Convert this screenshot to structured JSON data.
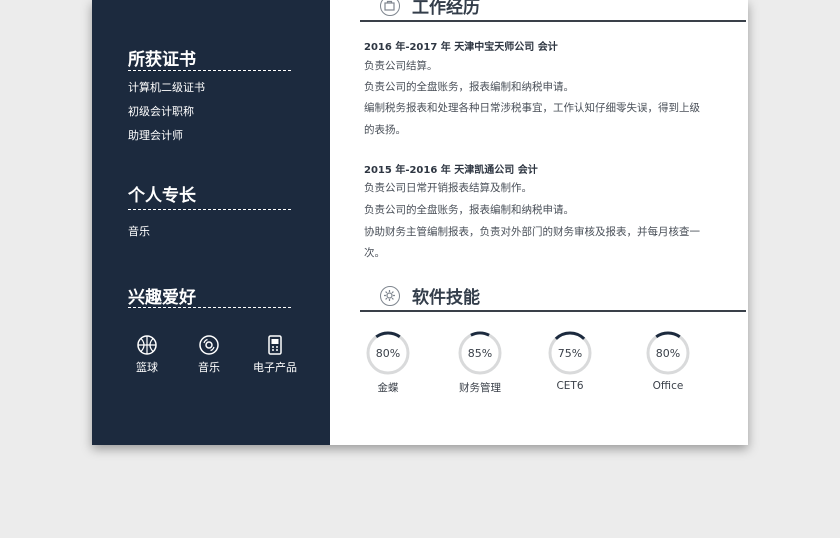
{
  "sidebar": {
    "certs": {
      "title": "所获证书",
      "items": [
        "计算机二级证书",
        "初级会计职称",
        "助理会计师"
      ]
    },
    "skills": {
      "title": "个人专长",
      "items": [
        "音乐"
      ]
    },
    "hobbies": {
      "title": "兴趣爱好",
      "items": [
        {
          "label": "篮球",
          "icon": "basketball-icon"
        },
        {
          "label": "音乐",
          "icon": "music-disc-icon"
        },
        {
          "label": "电子产品",
          "icon": "device-icon"
        }
      ]
    }
  },
  "main": {
    "work": {
      "title": "工作经历",
      "icon": "briefcase-icon",
      "jobs": [
        {
          "header": "2016 年-2017 年  天津中宝天师公司  会计",
          "lines": [
            "负责公司结算。",
            "负责公司的全盘账务，报表编制和纳税申请。",
            "编制税务报表和处理各种日常涉税事宜，工作认知仔细零失误，得到上级",
            "的表扬。"
          ]
        },
        {
          "header": "2015 年-2016 年  天津凯通公司  会计",
          "lines": [
            "负责公司日常开销报表结算及制作。",
            "负责公司的全盘账务，报表编制和纳税申请。",
            "协助财务主管编制报表，负责对外部门的财务审核及报表，并每月核查一",
            "次。"
          ]
        }
      ]
    },
    "software": {
      "title": "软件技能",
      "icon": "gear-icon",
      "items": [
        {
          "name": "金蝶",
          "percent": 80,
          "label": "80%"
        },
        {
          "name": "财务管理",
          "percent": 85,
          "label": "85%"
        },
        {
          "name": "CET6",
          "percent": 75,
          "label": "75%"
        },
        {
          "name": "Office",
          "percent": 80,
          "label": "80%"
        }
      ]
    }
  },
  "colors": {
    "sidebar": "#1c2a3e",
    "ring_track": "#d9dadb",
    "ring_fill": "#1c2a3e"
  }
}
